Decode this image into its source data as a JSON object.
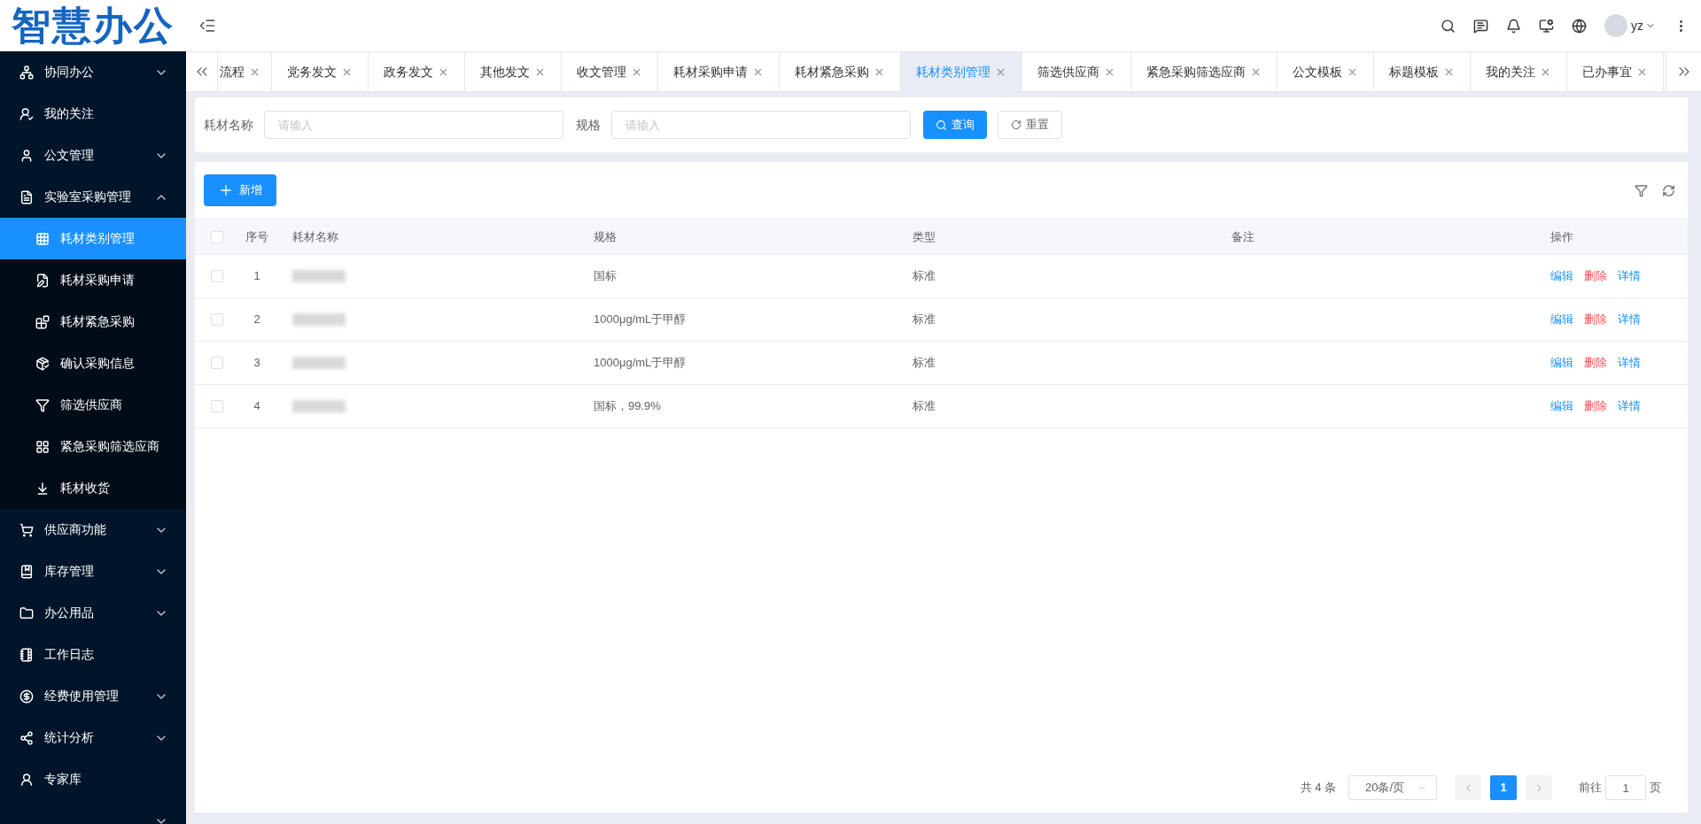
{
  "logo": "智慧办公",
  "header": {
    "user": "yz"
  },
  "sidebar": {
    "items": [
      {
        "label": "协同办公",
        "kind": "group",
        "expanded": false,
        "selected": false
      },
      {
        "label": "我的关注",
        "kind": "link",
        "selected": false
      },
      {
        "label": "公文管理",
        "kind": "group",
        "expanded": false,
        "selected": false
      },
      {
        "label": "实验室采购管理",
        "kind": "group",
        "expanded": true,
        "selected": false,
        "children": [
          {
            "label": "耗材类别管理",
            "selected": true
          },
          {
            "label": "耗材采购申请",
            "selected": false
          },
          {
            "label": "耗材紧急采购",
            "selected": false
          },
          {
            "label": "确认采购信息",
            "selected": false
          },
          {
            "label": "筛选供应商",
            "selected": false
          },
          {
            "label": "紧急采购筛选应商",
            "selected": false
          },
          {
            "label": "耗材收货",
            "selected": false
          }
        ]
      },
      {
        "label": "供应商功能",
        "kind": "group",
        "expanded": false,
        "selected": false
      },
      {
        "label": "库存管理",
        "kind": "group",
        "expanded": false,
        "selected": false
      },
      {
        "label": "办公用品",
        "kind": "group",
        "expanded": false,
        "selected": false
      },
      {
        "label": "工作日志",
        "kind": "link",
        "selected": false
      },
      {
        "label": "经费使用管理",
        "kind": "group",
        "expanded": false,
        "selected": false
      },
      {
        "label": "统计分析",
        "kind": "group",
        "expanded": false,
        "selected": false
      },
      {
        "label": "专家库",
        "kind": "link",
        "selected": false
      },
      {
        "kind": "group",
        "expanded": false,
        "selected": false
      }
    ]
  },
  "tabs": [
    {
      "label": "流程",
      "selected": false
    },
    {
      "label": "党务发文",
      "selected": false
    },
    {
      "label": "政务发文",
      "selected": false
    },
    {
      "label": "其他发文",
      "selected": false
    },
    {
      "label": "收文管理",
      "selected": false
    },
    {
      "label": "耗材采购申请",
      "selected": false
    },
    {
      "label": "耗材紧急采购",
      "selected": false
    },
    {
      "label": "耗材类别管理",
      "selected": true
    },
    {
      "label": "筛选供应商",
      "selected": false
    },
    {
      "label": "紧急采购筛选应商",
      "selected": false
    },
    {
      "label": "公文模板",
      "selected": false
    },
    {
      "label": "标题模板",
      "selected": false
    },
    {
      "label": "我的关注",
      "selected": false
    },
    {
      "label": "已办事宜",
      "selected": false
    }
  ],
  "search": {
    "fields": [
      {
        "label": "耗材名称",
        "placeholder": "请输入"
      },
      {
        "label": "规格",
        "placeholder": "请输入"
      }
    ],
    "buttons": [
      {
        "label": "查询",
        "kind": "primary"
      },
      {
        "label": "重置",
        "kind": "default"
      }
    ]
  },
  "table": {
    "add_button": "新增",
    "header_checked": false,
    "columns": [
      "序号",
      "耗材名称",
      "规格",
      "类型",
      "备注",
      "操作"
    ],
    "rows": [
      {
        "checked": false,
        "index": "1",
        "spec": "国标",
        "type": "标准",
        "actions": [
          {
            "label": "编辑",
            "kind": "link"
          },
          {
            "label": "删除",
            "kind": "danger"
          },
          {
            "label": "详情",
            "kind": "link"
          }
        ]
      },
      {
        "checked": false,
        "index": "2",
        "spec": "1000μg/mL于甲醇",
        "type": "标准",
        "actions": [
          {
            "label": "编辑",
            "kind": "link"
          },
          {
            "label": "删除",
            "kind": "danger"
          },
          {
            "label": "详情",
            "kind": "link"
          }
        ]
      },
      {
        "checked": false,
        "index": "3",
        "spec": "1000μg/mL于甲醇",
        "type": "标准",
        "actions": [
          {
            "label": "编辑",
            "kind": "link"
          },
          {
            "label": "删除",
            "kind": "danger"
          },
          {
            "label": "详情",
            "kind": "link"
          }
        ]
      },
      {
        "checked": false,
        "index": "4",
        "spec": "国标，99.9%",
        "type": "标准",
        "actions": [
          {
            "label": "编辑",
            "kind": "link"
          },
          {
            "label": "删除",
            "kind": "danger"
          },
          {
            "label": "详情",
            "kind": "link"
          }
        ]
      }
    ]
  },
  "pagination": {
    "total": "共 4 条",
    "page_size": "20条/页",
    "pages": [
      {
        "label": "1",
        "selected": true
      }
    ],
    "goto_label": "前往",
    "goto_value": "1",
    "goto_suffix": "页"
  }
}
